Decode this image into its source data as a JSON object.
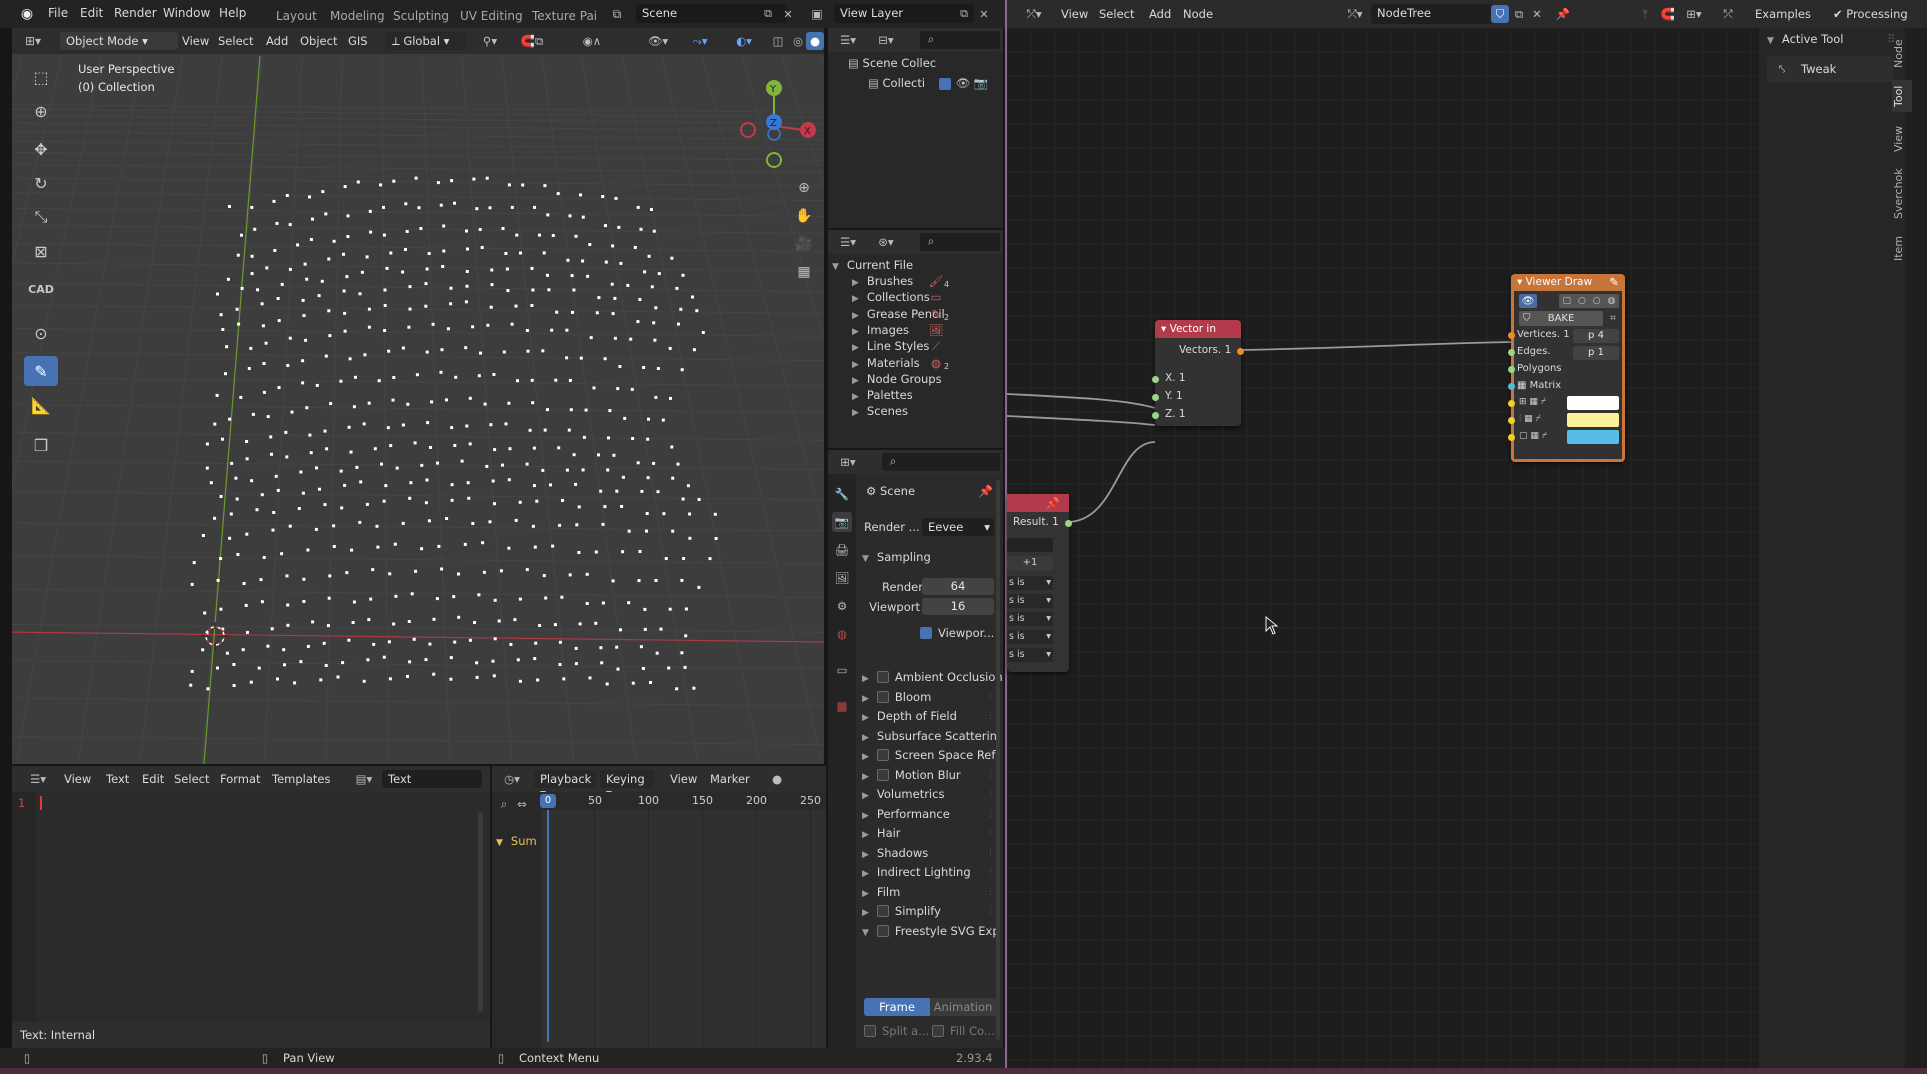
{
  "app": {
    "menus": [
      "File",
      "Edit",
      "Render",
      "Window",
      "Help"
    ],
    "workspaces": [
      "Layout",
      "Modeling",
      "Sculpting",
      "UV Editing",
      "Texture Paint"
    ],
    "scene": "Scene",
    "view_layer": "View Layer"
  },
  "viewport": {
    "mode": "Object Mode",
    "menus": [
      "View",
      "Select",
      "Add",
      "Object",
      "GIS"
    ],
    "orientation": "Global",
    "overlay_title": "User Perspective",
    "overlay_sub": "(0) Collection",
    "gizmo": {
      "x": "X",
      "y": "Y",
      "z": "Z"
    },
    "tools": [
      "select-tool",
      "cursor-tool",
      "move-tool",
      "rotate-tool",
      "scale-tool",
      "transform-tool",
      "cad-tool",
      "measure-tool",
      "annotate-tool",
      "ruler-tool",
      "add-cube-tool"
    ],
    "colors": {
      "x_axis": "#c43a4a",
      "y_axis": "#7fb53a",
      "z_axis": "#3a78d8",
      "points": "#ffffff"
    }
  },
  "outliner_top": {
    "items": [
      {
        "label": "Scene Collec"
      },
      {
        "label": "Collecti"
      }
    ]
  },
  "outliner_data": {
    "root": "Current File",
    "items": [
      "Brushes",
      "Collections",
      "Grease Pencil",
      "Images",
      "Line Styles",
      "Materials",
      "Node Groups",
      "Palettes",
      "Scenes"
    ],
    "badges": [
      "4",
      "",
      "2",
      "",
      "",
      "2",
      "",
      "",
      ""
    ]
  },
  "properties": {
    "scene_label": "Scene",
    "render_engine_label": "Render ...",
    "render_engine": "Eevee",
    "sampling": {
      "title": "Sampling",
      "render_label": "Render",
      "render_value": "64",
      "viewport_label": "Viewport",
      "viewport_value": "16",
      "denoise": "Viewpor..."
    },
    "panels": [
      {
        "label": "Ambient Occlusion",
        "checkbox": true
      },
      {
        "label": "Bloom",
        "checkbox": true
      },
      {
        "label": "Depth of Field",
        "checkbox": false
      },
      {
        "label": "Subsurface Scatterin",
        "checkbox": false
      },
      {
        "label": "Screen Space Refl",
        "checkbox": true
      },
      {
        "label": "Motion Blur",
        "checkbox": true
      },
      {
        "label": "Volumetrics",
        "checkbox": false
      },
      {
        "label": "Performance",
        "checkbox": false
      },
      {
        "label": "Hair",
        "checkbox": false
      },
      {
        "label": "Shadows",
        "checkbox": false
      },
      {
        "label": "Indirect Lighting",
        "checkbox": false
      },
      {
        "label": "Film",
        "checkbox": false
      },
      {
        "label": "Simplify",
        "checkbox": true
      },
      {
        "label": "Freestyle SVG Exp",
        "checkbox": true
      }
    ],
    "freestyle_tabs": [
      "Frame",
      "Animation"
    ],
    "freestyle_opts": [
      "Split a...",
      "Fill Co..."
    ]
  },
  "text_editor": {
    "menus": [
      "View",
      "Text",
      "Edit",
      "Select",
      "Format",
      "Templates"
    ],
    "text_name": "Text",
    "line_number": "1",
    "status": "Text: Internal"
  },
  "timeline": {
    "menus": [
      "Playback",
      "Keying",
      "View",
      "Marker"
    ],
    "frame_current": "0",
    "ticks": [
      "50",
      "100",
      "150",
      "200",
      "250"
    ],
    "summary": "Sum"
  },
  "statusbar": {
    "pan": "Pan View",
    "context": "Context Menu",
    "version": "2.93.4"
  },
  "node_editor": {
    "menus": [
      "View",
      "Select",
      "Add",
      "Node"
    ],
    "tree_name": "NodeTree",
    "right_labels": [
      "Examples",
      "Processing"
    ],
    "active_tool_title": "Active Tool",
    "active_tool": "Tweak",
    "side_tabs": [
      "Node",
      "Tool",
      "View",
      "Sverchok",
      "Item"
    ],
    "vector_in": {
      "title": "Vector in",
      "output": "Vectors. 1",
      "inputs": [
        "X. 1",
        "Y. 1",
        "Z. 1"
      ]
    },
    "viewer_draw": {
      "title": "Viewer Draw",
      "bake": "BAKE",
      "inputs": [
        "Vertices. 1",
        "Edges.",
        "Polygons",
        "Matrix"
      ],
      "vert_field": "p 4",
      "edge_field": "p 1",
      "colors": {
        "header": "#c8753a",
        "body": "#323232",
        "color1": "#ffffff",
        "color2": "#fdf09a",
        "color3": "#55bde8"
      }
    },
    "partial_node": {
      "output": "Result. 1",
      "field": "+1",
      "rows": [
        "s is",
        "s is",
        "s is",
        "s is",
        "s is"
      ]
    }
  }
}
